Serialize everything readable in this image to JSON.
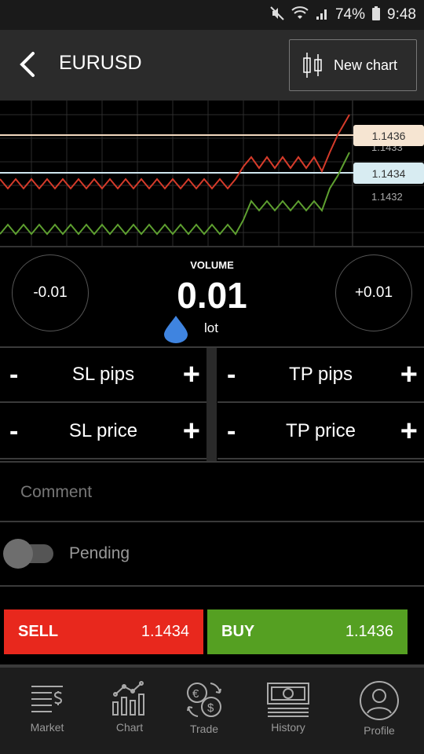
{
  "status": {
    "battery": "74%",
    "time": "9:48"
  },
  "header": {
    "title": "EURUSD",
    "new_chart_label": "New chart"
  },
  "chart": {
    "tag_high": "1.1436",
    "tag_low": "1.1434",
    "axis_labels": [
      "1.1433",
      "1.1432"
    ],
    "colors": {
      "sell_line": "#d63b2a",
      "buy_line": "#5ea030",
      "ask_tag": "#f6e5d2",
      "bid_tag": "#d8ecf2"
    }
  },
  "volume": {
    "label": "VOLUME",
    "value": "0.01",
    "unit": "lot",
    "decrement": "-0.01",
    "increment": "+0.01"
  },
  "steppers": {
    "sl_pips": "SL pips",
    "tp_pips": "TP pips",
    "sl_price": "SL price",
    "tp_price": "TP price",
    "minus": "-",
    "plus": "+"
  },
  "comment": {
    "placeholder": "Comment"
  },
  "pending": {
    "label": "Pending",
    "enabled": false
  },
  "trade": {
    "sell_label": "SELL",
    "sell_price": "1.1434",
    "buy_label": "BUY",
    "buy_price": "1.1436"
  },
  "nav": [
    {
      "label": "Market",
      "icon": "market-icon"
    },
    {
      "label": "Chart",
      "icon": "chart-icon"
    },
    {
      "label": "Trade",
      "icon": "trade-icon"
    },
    {
      "label": "History",
      "icon": "history-icon"
    },
    {
      "label": "Profile",
      "icon": "profile-icon"
    }
  ]
}
